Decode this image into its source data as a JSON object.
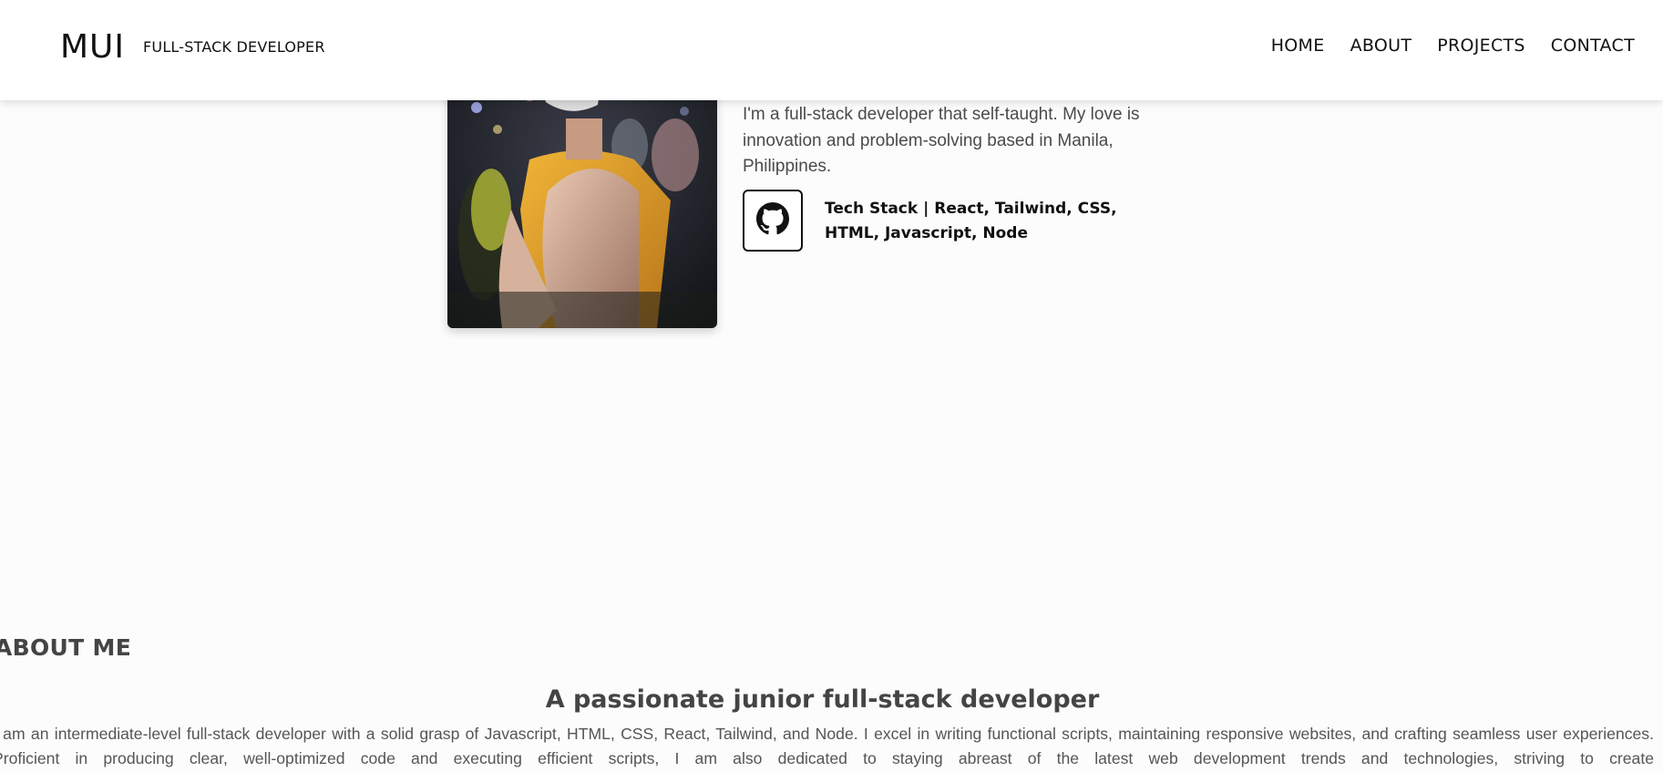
{
  "header": {
    "brand": "MUI",
    "subtitle": "FULL-STACK DEVELOPER",
    "nav": [
      {
        "label": "HOME"
      },
      {
        "label": "ABOUT"
      },
      {
        "label": "PROJECTS"
      },
      {
        "label": "CONTACT"
      }
    ]
  },
  "hero": {
    "intro": "I'm a full-stack developer that self-taught. My love is innovation and problem-solving based in Manila, Philippines.",
    "github_icon": "github-icon",
    "tech_stack": "Tech Stack | React, Tailwind, CSS, HTML, Javascript, Node"
  },
  "about": {
    "heading": "ABOUT ME",
    "title": "A passionate junior full-stack developer",
    "body": "I am an intermediate-level full-stack developer with a solid grasp of Javascript, HTML, CSS, React, Tailwind, and Node. I excel in writing functional scripts, maintaining responsive websites, and crafting seamless user experiences. Proficient in producing clear, well-optimized code and executing efficient scripts, I am also dedicated to staying abreast of the latest web development trends and technologies, striving to create"
  },
  "colors": {
    "accent_photo_shirt": "#e0a326",
    "text_dark": "#111111",
    "text_muted": "#4a4a4a"
  }
}
